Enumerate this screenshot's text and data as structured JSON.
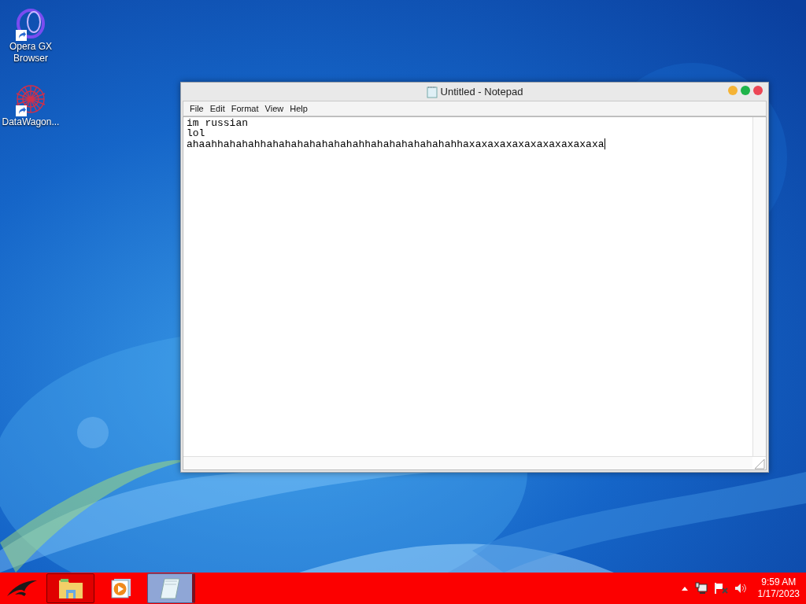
{
  "desktop_icons": [
    {
      "label": "Opera GX Browser",
      "kind": "opera"
    },
    {
      "label": "DataWagon...",
      "kind": "datawagon"
    }
  ],
  "window": {
    "title": "Untitled - Notepad",
    "menu": [
      "File",
      "Edit",
      "Format",
      "View",
      "Help"
    ],
    "lines": [
      "im russian",
      "lol",
      "ahaahhahahahhahahahahahahahahhahahahahahahahhaxaxaxaxaxaxaxaxaxaxaxa"
    ]
  },
  "taskbar": {
    "apps": [
      {
        "kind": "explorer",
        "running": true,
        "selected": false
      },
      {
        "kind": "media",
        "running": false,
        "selected": false
      },
      {
        "kind": "notepad",
        "running": true,
        "selected": true
      }
    ],
    "time": "9:59 AM",
    "date": "1/17/2023"
  }
}
